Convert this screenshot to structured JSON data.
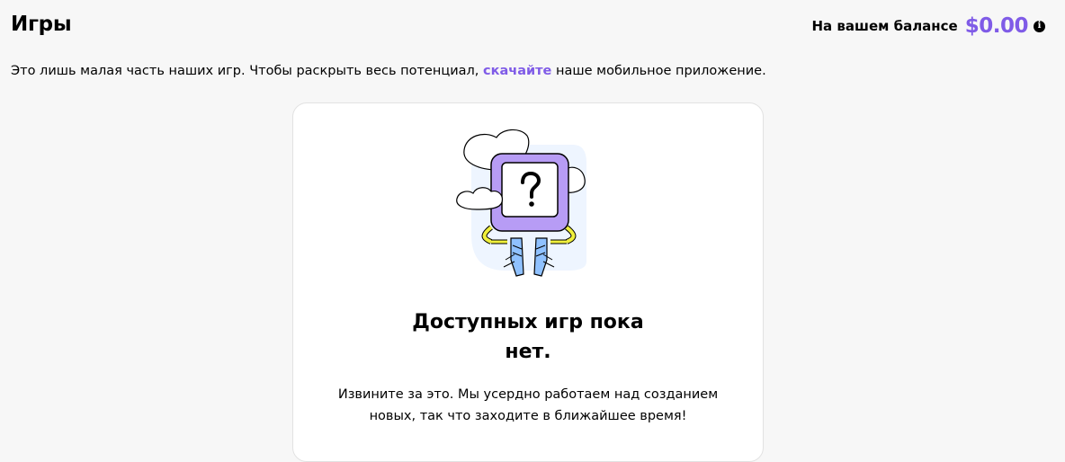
{
  "header": {
    "title": "Игры",
    "balance_label": "На вашем балансе",
    "balance_amount": "$0.00",
    "info_icon": "info-icon"
  },
  "intro": {
    "text_before": "Это лишь малая часть наших игр. Чтобы раскрыть весь потенциал, ",
    "link_text": "скачайте",
    "text_after": " наше мобильное приложение."
  },
  "empty_state": {
    "illustration": "question-box-character-with-clouds",
    "title": "Доступных игр пока нет.",
    "message": "Извините за это. Мы усердно работаем над созданием новых, так что заходите в ближайшее время!"
  },
  "colors": {
    "accent": "#7f5be7",
    "background": "#f7f7f7",
    "card": "#ffffff"
  }
}
